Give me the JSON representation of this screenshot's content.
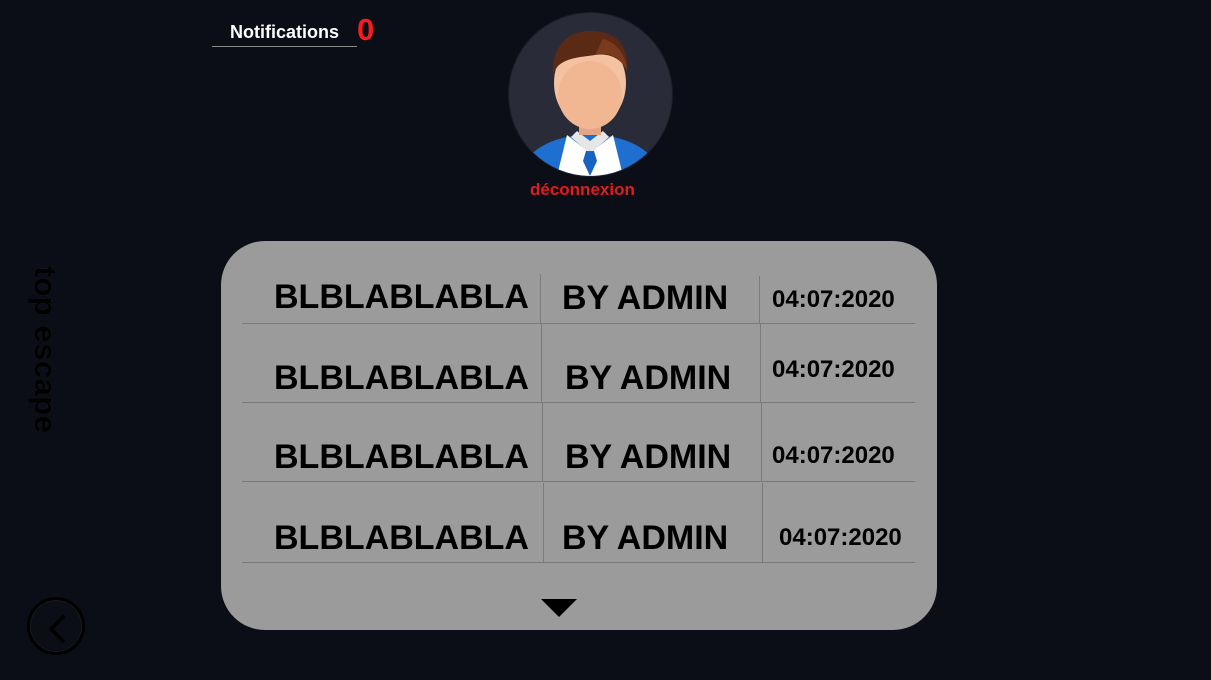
{
  "header": {
    "notifications_label": "Notifications",
    "notifications_count": "0",
    "logout_label": "déconnexion"
  },
  "sidebar": {
    "title": "top escape"
  },
  "feed": {
    "rows": [
      {
        "title": "BLBLABLABLA",
        "author": "BY ADMIN",
        "date": "04:07:2020"
      },
      {
        "title": "BLBLABLABLA",
        "author": "BY ADMIN",
        "date": "04:07:2020"
      },
      {
        "title": "BLBLABLABLA",
        "author": "BY ADMIN",
        "date": "04:07:2020"
      },
      {
        "title": "BLBLABLABLA",
        "author": "BY ADMIN",
        "date": "04:07:2020"
      }
    ],
    "more_icon": "triangle-down-icon"
  },
  "navigation": {
    "back_icon": "chevron-left-icon"
  },
  "colors": {
    "background": "#0b0d17",
    "panel": "#9b9b9b",
    "notification_count": "#ff1a1a",
    "logout": "#e41b1b"
  }
}
